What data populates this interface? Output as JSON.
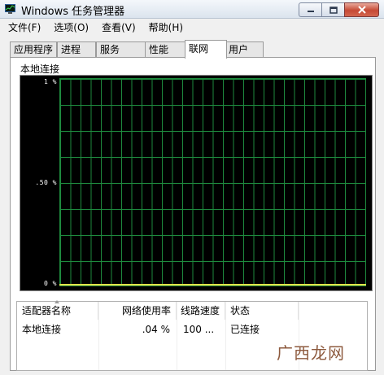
{
  "window": {
    "title": "Windows 任务管理器"
  },
  "menu": [
    "文件(F)",
    "选项(O)",
    "查看(V)",
    "帮助(H)"
  ],
  "tabs": [
    "应用程序",
    "进程",
    "服务",
    "性能",
    "联网",
    "用户"
  ],
  "active_tab": "联网",
  "graph": {
    "label": "本地连接",
    "y_labels": [
      "1 %",
      ".50 %",
      "0 %"
    ],
    "line_color": "#e2e24a",
    "grid_color": "#1e8a3e",
    "background": "#000000",
    "current_usage_percent": 0.04
  },
  "table": {
    "headers": [
      "适配器名称",
      "网络使用率",
      "线路速度",
      "状态"
    ],
    "rows": [
      {
        "name": "本地连接",
        "usage": ".04 %",
        "speed": "100 ...",
        "status": "已连接"
      }
    ]
  },
  "watermark": "广西龙网"
}
